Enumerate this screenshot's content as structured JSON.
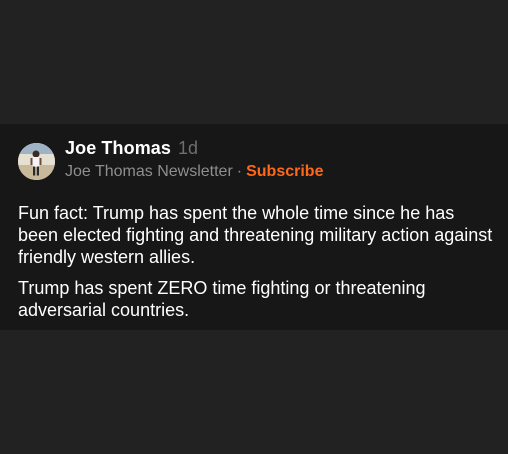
{
  "post": {
    "author": "Joe Thomas",
    "age": "1d",
    "newsletter": "Joe Thomas Newsletter",
    "separator": "·",
    "subscribe_label": "Subscribe",
    "paragraphs": [
      "Fun fact: Trump has spent the whole time since he has been elected fighting and threatening military action against friendly western allies.",
      "Trump has spent ZERO time fighting or threatening adversarial countries."
    ]
  },
  "colors": {
    "page_background": "#222222",
    "card_background": "#171717",
    "accent": "#ff6719",
    "muted_text": "#8e8e8e"
  },
  "icons": {
    "avatar": "profile-photo"
  }
}
